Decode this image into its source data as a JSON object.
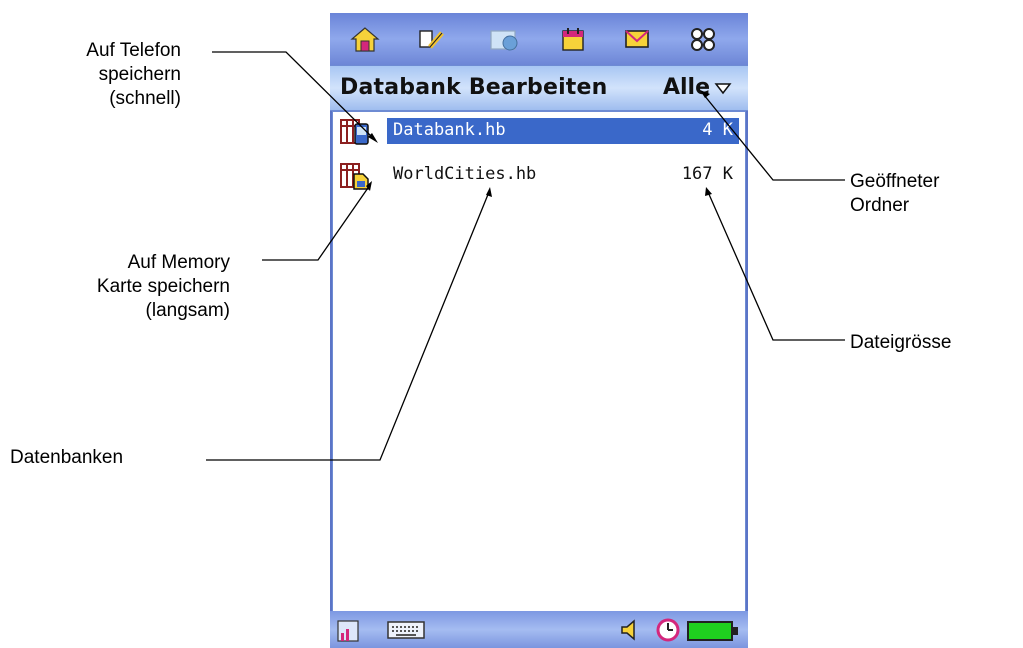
{
  "app": {
    "title": "Databank Bearbeiten",
    "folder": "Alle",
    "top_icons": [
      "home-icon",
      "tools-icon",
      "web-icon",
      "calendar-icon",
      "mail-icon",
      "apps-grid-icon"
    ],
    "files": [
      {
        "name": "Databank.hb",
        "size": "4 K",
        "selected": true,
        "storage": "phone"
      },
      {
        "name": "WorldCities.hb",
        "size": "167 K",
        "selected": false,
        "storage": "memory-card"
      }
    ],
    "bottom_icons": [
      "chart-icon",
      "keyboard-icon",
      "speaker-icon",
      "clock-icon",
      "battery-icon"
    ]
  },
  "annotations": {
    "phone_storage": [
      "Auf Telefon",
      "speichern",
      "(schnell)"
    ],
    "card_storage": [
      "Auf Memory",
      "Karte speichern",
      "(langsam)"
    ],
    "databases": "Datenbanken",
    "open_folder": [
      "Geöffneter",
      "Ordner"
    ],
    "file_size": "Dateigrösse"
  },
  "colors": {
    "selection": "#3a68c9",
    "topbar": "#6a84d8",
    "titlebar": "#c2d6f8",
    "battery": "#1fd11f"
  }
}
